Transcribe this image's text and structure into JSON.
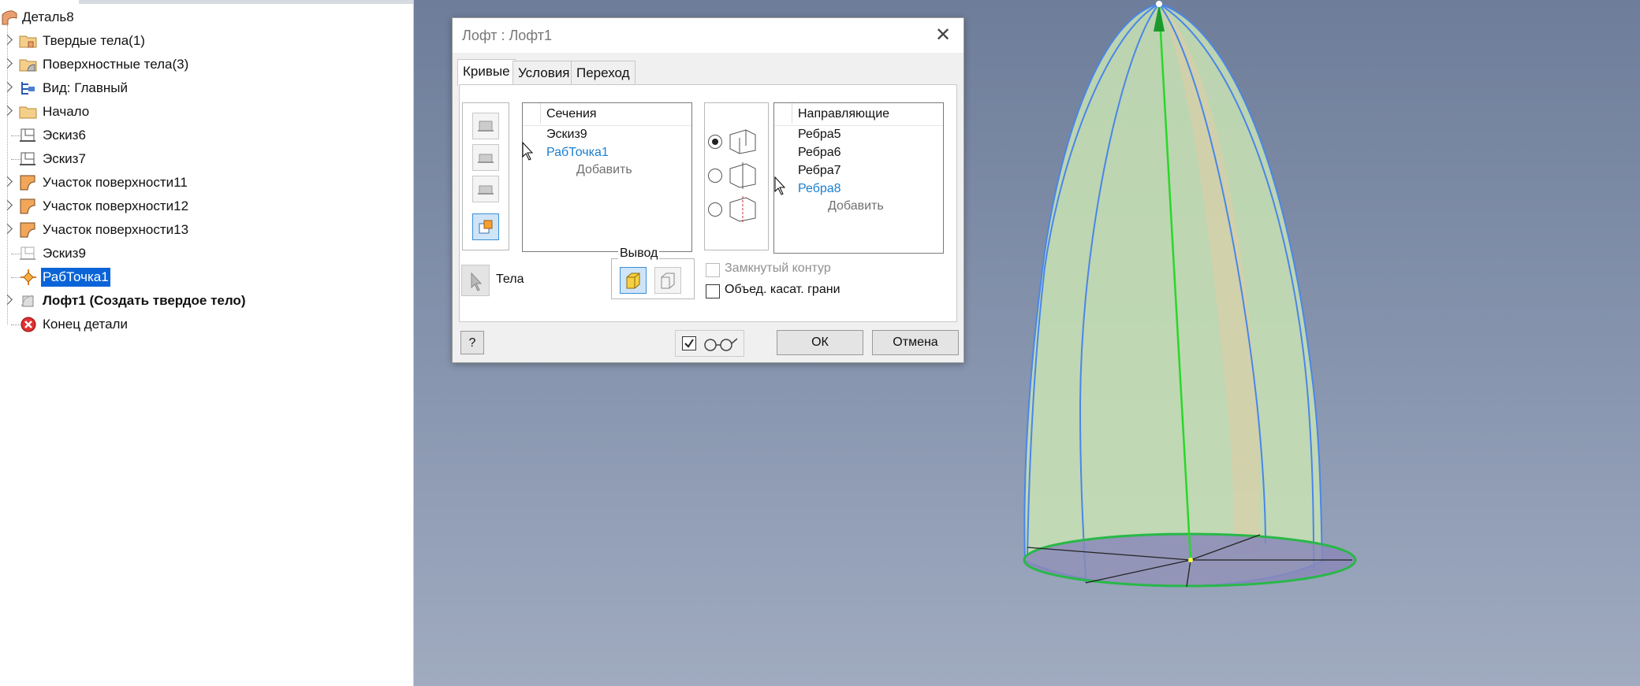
{
  "browser": {
    "items": [
      {
        "label": "Деталь8",
        "icon": "part-icon",
        "expander": false
      },
      {
        "label": "Твердые тела(1)",
        "icon": "solid-bodies-folder-icon",
        "expander": true
      },
      {
        "label": "Поверхностные тела(3)",
        "icon": "surface-bodies-folder-icon",
        "expander": true
      },
      {
        "label": "Вид: Главный",
        "icon": "view-rep-icon",
        "expander": true
      },
      {
        "label": "Начало",
        "icon": "origin-folder-icon",
        "expander": true
      },
      {
        "label": "Эскиз6",
        "icon": "sketch-icon",
        "expander": false
      },
      {
        "label": "Эскиз7",
        "icon": "sketch-icon",
        "expander": false
      },
      {
        "label": "Участок поверхности11",
        "icon": "surface-patch-icon",
        "expander": true
      },
      {
        "label": "Участок поверхности12",
        "icon": "surface-patch-icon",
        "expander": true
      },
      {
        "label": "Участок поверхности13",
        "icon": "surface-patch-icon",
        "expander": true
      },
      {
        "label": "Эскиз9",
        "icon": "sketch-icon",
        "expander": false
      },
      {
        "label": "РабТочка1",
        "icon": "work-point-icon",
        "expander": false,
        "selected": true
      },
      {
        "label": "Лофт1 (Создать твердое тело)",
        "icon": "loft-icon",
        "expander": true,
        "bold": true
      },
      {
        "label": "Конец детали",
        "icon": "end-of-part-icon",
        "expander": false
      }
    ]
  },
  "dialog": {
    "title": "Лофт : Лофт1",
    "tabs": [
      "Кривые",
      "Условия",
      "Переход"
    ],
    "sections": {
      "header": "Сечения",
      "items": [
        "Эскиз9",
        "РабТочка1"
      ],
      "add": "Добавить"
    },
    "rails": {
      "header": "Направляющие",
      "items": [
        "Ребра5",
        "Ребра6",
        "Ребра7",
        "Ребра8"
      ],
      "add": "Добавить"
    },
    "bodies_label": "Тела",
    "output": {
      "label": "Вывод"
    },
    "closed_loop": "Замкнутый контур",
    "merge_tangent": "Объед. касат. грани",
    "ok": "ОК",
    "cancel": "Отмена",
    "help": "?"
  },
  "colors": {
    "selection": "#0a64d8",
    "highlight_blue": "#1a7fd0",
    "shape_fill": "#c9e3b4",
    "edge_blue": "#4a86e8",
    "axis_green": "#28d828"
  }
}
